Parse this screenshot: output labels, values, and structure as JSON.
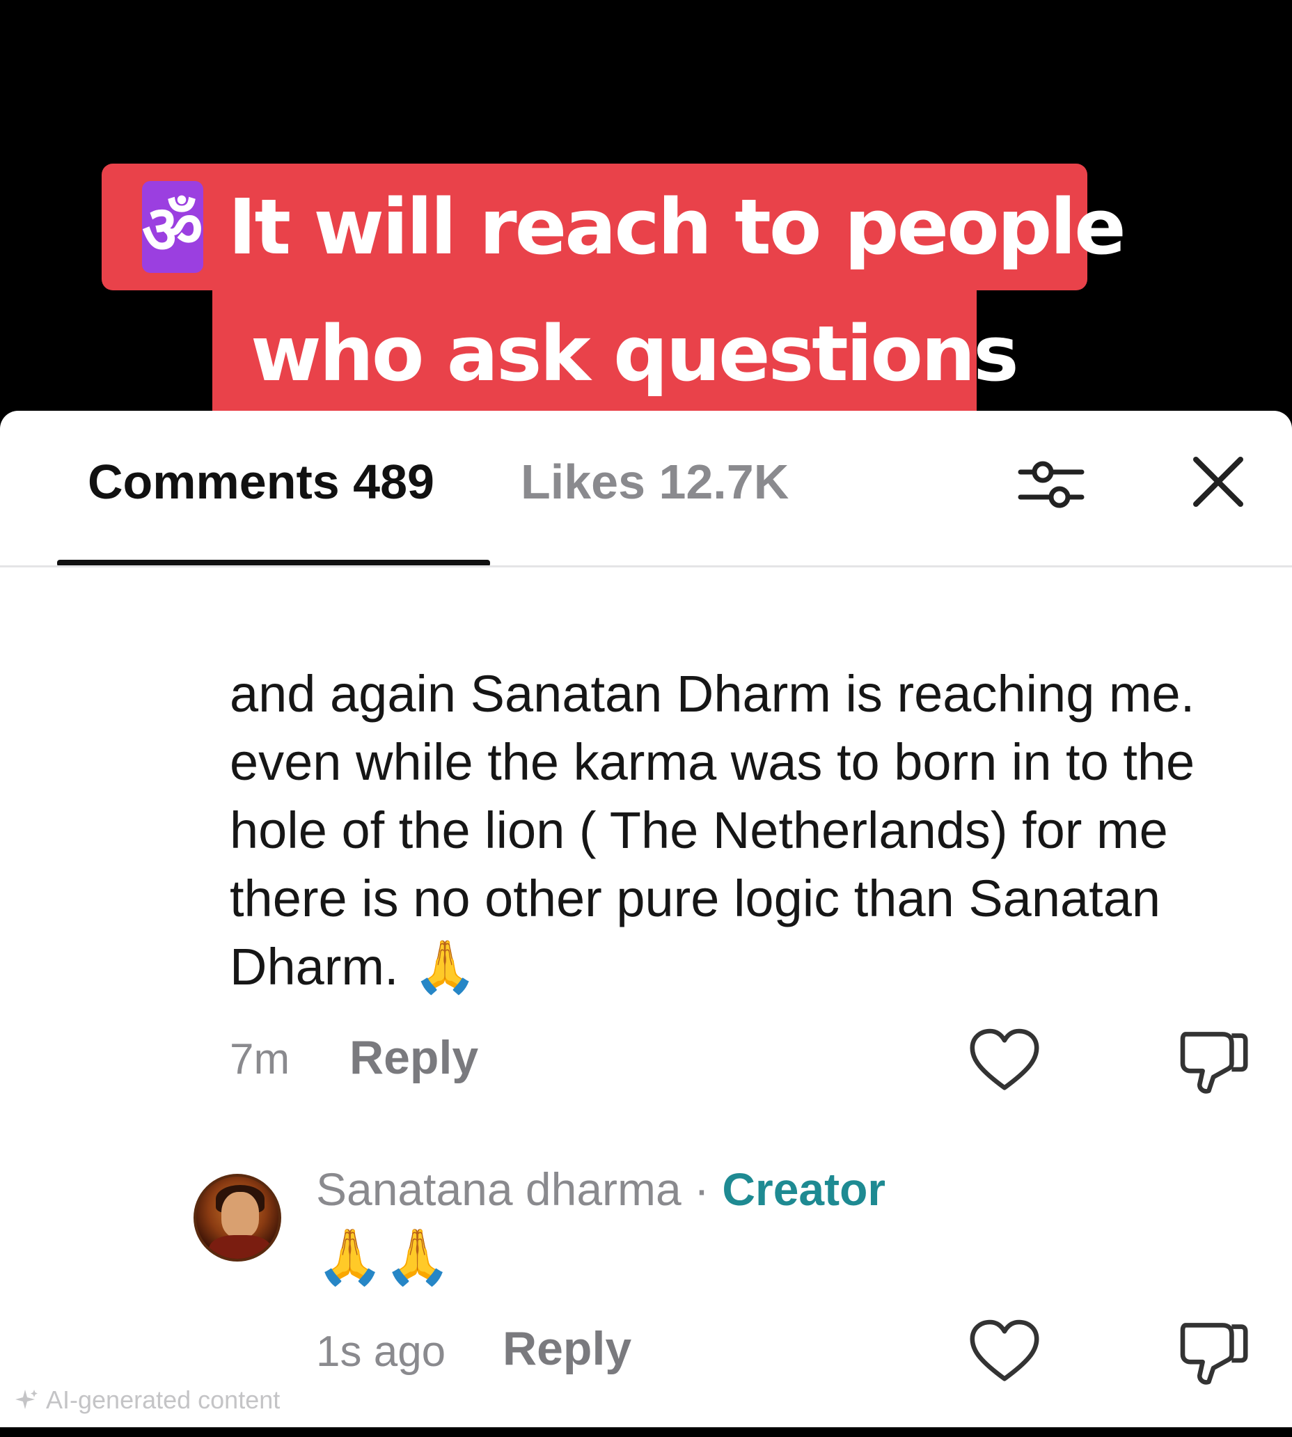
{
  "caption": {
    "icon": "om-icon",
    "icon_glyph": "ॐ",
    "line1": "It will reach to people",
    "line2": "who ask questions",
    "background_color": "#e9424a",
    "icon_bg_color": "#9b3fe0"
  },
  "tabs": {
    "comments_label": "Comments 489",
    "likes_label": "Likes 12.7K",
    "active": "comments"
  },
  "toolbar": {
    "filter_icon": "sliders-icon",
    "close_icon": "close-icon"
  },
  "comments": [
    {
      "text": "and again Sanatan Dharm is reaching me. even while the karma was to born in to the hole of the lion ( The Netherlands) for me there is no other pure logic than Sanatan Dharm. 🙏",
      "time": "7m",
      "reply_label": "Reply",
      "like_icon": "heart-icon",
      "dislike_icon": "thumbs-down-icon"
    },
    {
      "author": "Sanatana dharma",
      "separator": " · ",
      "badge": "Creator",
      "text": "🙏🙏",
      "time": "1s ago",
      "reply_label": "Reply",
      "like_icon": "heart-icon",
      "dislike_icon": "thumbs-down-icon"
    }
  ],
  "footer": {
    "ai_label": "AI-generated content",
    "ai_icon": "sparkle-icon"
  },
  "colors": {
    "creator_badge": "#1e8a92",
    "muted_text": "#8a8a8e"
  }
}
